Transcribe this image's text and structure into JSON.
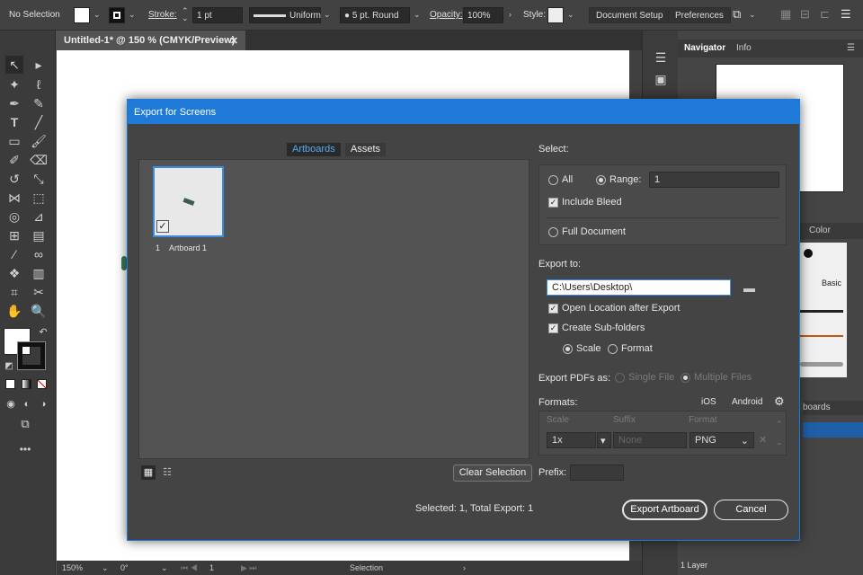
{
  "control_bar": {
    "selection": "No Selection",
    "stroke_label": "Stroke:",
    "stroke_value": "1 pt",
    "profile": "Uniform",
    "brush": "5 pt. Round",
    "opacity_label": "Opacity:",
    "opacity_value": "100%",
    "style_label": "Style:",
    "document_setup": "Document Setup",
    "preferences": "Preferences"
  },
  "document_tab": {
    "title": "Untitled-1* @ 150 % (CMYK/Preview)",
    "close": "✕"
  },
  "status_bar": {
    "zoom": "150%",
    "rotation": "0°",
    "artboard": "1",
    "tool": "Selection"
  },
  "right_panel": {
    "tabs": [
      "Navigator",
      "Info"
    ],
    "color_tab": "Color",
    "brush_label": "Basic",
    "artboards_tab": "boards",
    "layers": "1 Layer"
  },
  "dialog": {
    "title": "Export for Screens",
    "tabs": {
      "artboards": "Artboards",
      "assets": "Assets"
    },
    "artboard_item": {
      "number": "1",
      "name": "Artboard 1"
    },
    "clear_selection": "Clear Selection",
    "summary": "Selected: 1, Total Export: 1",
    "select": {
      "heading": "Select:",
      "all": "All",
      "range": "Range:",
      "range_value": "1",
      "include_bleed": "Include Bleed",
      "full_document": "Full Document"
    },
    "export_to": {
      "heading": "Export to:",
      "path": "C:\\Users\\Desktop\\",
      "open_location": "Open Location after Export",
      "create_subfolders": "Create Sub-folders",
      "scale": "Scale",
      "format": "Format"
    },
    "pdf": {
      "heading": "Export PDFs as:",
      "single": "Single File",
      "multiple": "Multiple Files"
    },
    "formats": {
      "heading": "Formats:",
      "ios": "iOS",
      "android": "Android",
      "columns": [
        "Scale",
        "Suffix",
        "Format"
      ],
      "row": {
        "scale": "1x",
        "suffix_placeholder": "None",
        "format": "PNG"
      }
    },
    "prefix_label": "Prefix:",
    "export_button": "Export Artboard",
    "cancel_button": "Cancel"
  },
  "colors": {
    "accent": "#1e7ad6",
    "dialog_bg": "#444444",
    "app_bg": "#535353"
  }
}
